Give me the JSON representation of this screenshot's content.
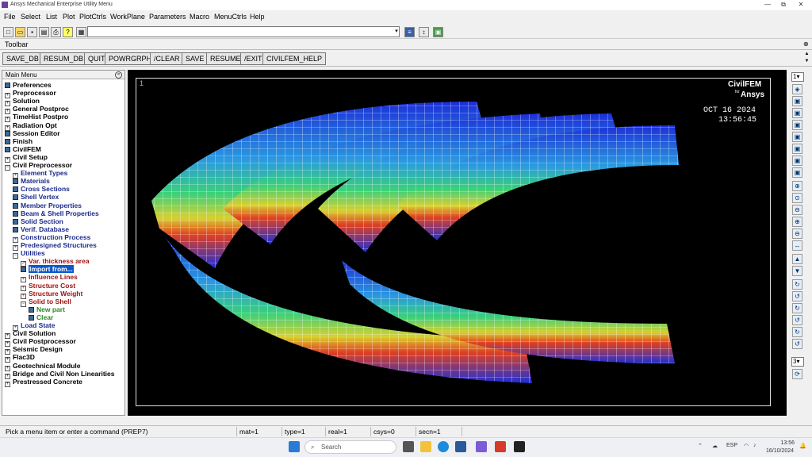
{
  "window": {
    "title": "Ansys Mechanical Enterprise Utility Menu",
    "min": "—",
    "max": "⧉",
    "close": "✕"
  },
  "menubar": [
    "File",
    "Select",
    "List",
    "Plot",
    "PlotCtrls",
    "WorkPlane",
    "Parameters",
    "Macro",
    "MenuCtrls",
    "Help"
  ],
  "command_line": {
    "value": ""
  },
  "toolbar": {
    "label": "Toolbar",
    "buttons": [
      "SAVE_DB",
      "RESUM_DB",
      "QUIT",
      "POWRGRPH",
      "/CLEAR",
      "SAVE",
      "RESUME",
      "/EXIT",
      "CIVILFEM_HELP"
    ]
  },
  "main_menu": {
    "title": "Main Menu",
    "items": [
      {
        "label": "Preferences",
        "icon": "box-icon",
        "color": "black"
      },
      {
        "label": "Preprocessor",
        "icon": "plus-icon",
        "color": "black"
      },
      {
        "label": "Solution",
        "icon": "plus-icon",
        "color": "black"
      },
      {
        "label": "General Postproc",
        "icon": "plus-icon",
        "color": "black"
      },
      {
        "label": "TimeHist Postpro",
        "icon": "plus-icon",
        "color": "black"
      },
      {
        "label": "Radiation Opt",
        "icon": "plus-icon",
        "color": "black"
      },
      {
        "label": "Session Editor",
        "icon": "box-icon",
        "color": "black"
      },
      {
        "label": "Finish",
        "icon": "box-icon",
        "color": "black"
      },
      {
        "label": "CivilFEM",
        "icon": "box-icon",
        "color": "black"
      },
      {
        "label": "Civil Setup",
        "icon": "plus-icon",
        "color": "black"
      },
      {
        "label": "Civil Preprocessor",
        "icon": "minus-icon",
        "color": "black"
      },
      {
        "label": "Element Types",
        "icon": "plus-icon",
        "color": "blue",
        "indent": 1
      },
      {
        "label": "Materials",
        "icon": "box-icon",
        "color": "blue",
        "indent": 1
      },
      {
        "label": "Cross Sections",
        "icon": "box-icon",
        "color": "blue",
        "indent": 1
      },
      {
        "label": "Shell Vertex",
        "icon": "box-icon",
        "color": "blue",
        "indent": 1
      },
      {
        "label": "Member Properties",
        "icon": "box-icon",
        "color": "blue",
        "indent": 1
      },
      {
        "label": "Beam & Shell Properties",
        "icon": "box-icon",
        "color": "blue",
        "indent": 1
      },
      {
        "label": "Solid Section",
        "icon": "box-icon",
        "color": "blue",
        "indent": 1
      },
      {
        "label": "Verif. Database",
        "icon": "box-icon",
        "color": "blue",
        "indent": 1
      },
      {
        "label": "Construction Process",
        "icon": "plus-icon",
        "color": "blue",
        "indent": 1
      },
      {
        "label": "Predesigned Structures",
        "icon": "plus-icon",
        "color": "blue",
        "indent": 1
      },
      {
        "label": "Utilities",
        "icon": "minus-icon",
        "color": "blue",
        "indent": 1
      },
      {
        "label": "Var. thickness area",
        "icon": "arrow-icon",
        "color": "red",
        "indent": 2
      },
      {
        "label": "Import from...",
        "icon": "box-icon",
        "color": "red",
        "indent": 2,
        "selected": true
      },
      {
        "label": "Influence Lines",
        "icon": "plus-icon",
        "color": "red",
        "indent": 2
      },
      {
        "label": "Structure Cost",
        "icon": "plus-icon",
        "color": "red",
        "indent": 2
      },
      {
        "label": "Structure Weight",
        "icon": "plus-icon",
        "color": "red",
        "indent": 2
      },
      {
        "label": "Solid to Shell",
        "icon": "minus-icon",
        "color": "red",
        "indent": 2
      },
      {
        "label": "New part",
        "icon": "box-icon",
        "color": "green",
        "indent": 3
      },
      {
        "label": "Clear",
        "icon": "box-icon",
        "color": "green",
        "indent": 3
      },
      {
        "label": "Load State",
        "icon": "plus-icon",
        "color": "blue",
        "indent": 1
      },
      {
        "label": "Civil Solution",
        "icon": "plus-icon",
        "color": "black"
      },
      {
        "label": "Civil Postprocessor",
        "icon": "plus-icon",
        "color": "black"
      },
      {
        "label": "Seismic Design",
        "icon": "plus-icon",
        "color": "black"
      },
      {
        "label": "Flac3D",
        "icon": "plus-icon",
        "color": "black"
      },
      {
        "label": "Geotechnical Module",
        "icon": "plus-icon",
        "color": "black"
      },
      {
        "label": "Bridge and Civil Non Linearities",
        "icon": "plus-icon",
        "color": "black"
      },
      {
        "label": "Prestressed Concrete",
        "icon": "plus-icon",
        "color": "black"
      }
    ]
  },
  "graphics": {
    "window_number": "1",
    "brand_main": "CivilFEM",
    "brand_for": "for",
    "brand_sub": "Ansys",
    "date": "OCT 16 2024",
    "time": "13:56:45"
  },
  "view_toolbar": {
    "window_select": "1",
    "dynamic_select": "3"
  },
  "status_bar": {
    "prompt": "Pick a menu item or enter a command (PREP7)",
    "mat": "mat=1",
    "type": "type=1",
    "real": "real=1",
    "csys": "csys=0",
    "secn": "secn=1"
  },
  "taskbar": {
    "search_placeholder": "Search",
    "lang": "ESP",
    "clock_time": "13:56",
    "clock_date": "16/10/2024"
  }
}
